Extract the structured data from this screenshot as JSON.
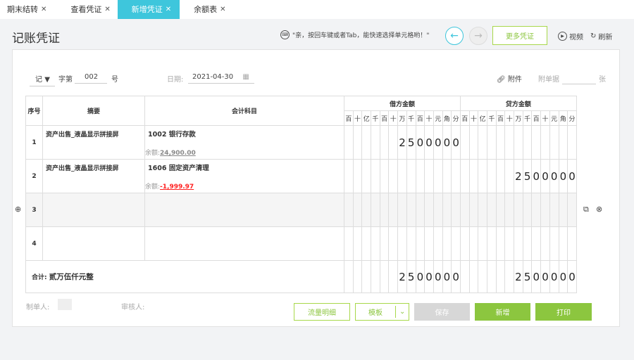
{
  "tabs": [
    {
      "label": "期末结转"
    },
    {
      "label": "查看凭证"
    },
    {
      "label": "新增凭证",
      "active": true
    },
    {
      "label": "余额表"
    }
  ],
  "page_title": "记账凭证",
  "hint": "\"亲，按回车键或者Tab，能快速选择单元格哟！\"",
  "more_vouchers": "更多凭证",
  "video": "视频",
  "refresh": "刷新",
  "voucher": {
    "type": "记",
    "word_label": "字第",
    "number": "002",
    "number_suffix": "号",
    "date_label": "日期:",
    "date": "2021-04-30",
    "attachment": "附件",
    "attach_count_label": "附单据",
    "attach_unit": "张"
  },
  "table": {
    "headers": {
      "index": "序号",
      "summary": "摘要",
      "account": "会计科目",
      "debit": "借方金额",
      "credit": "贷方金额"
    },
    "digit_units": [
      "百",
      "十",
      "亿",
      "千",
      "百",
      "十",
      "万",
      "千",
      "百",
      "十",
      "元",
      "角",
      "分"
    ],
    "rows": [
      {
        "index": "1",
        "summary": "资产出售_液晶显示拼接屏",
        "account": "1002 银行存款",
        "balance_label": "余额:",
        "balance": "24,900.00",
        "balance_negative": false,
        "debit": "2500000",
        "credit": ""
      },
      {
        "index": "2",
        "summary": "资产出售_液晶显示拼接屏",
        "account": "1606 固定资产清理",
        "balance_label": "余额:",
        "balance": "-1,999.97",
        "balance_negative": true,
        "debit": "",
        "credit": "2500000"
      },
      {
        "index": "3",
        "summary": "",
        "account": "",
        "debit": "",
        "credit": ""
      },
      {
        "index": "4",
        "summary": "",
        "account": "",
        "debit": "",
        "credit": ""
      }
    ],
    "total_label": "合计:",
    "total_words": "贰万伍仟元整",
    "total_debit": "2500000",
    "total_credit": "2500000"
  },
  "footer": {
    "maker_label": "制单人:",
    "reviewer_label": "审核人:"
  },
  "buttons": {
    "cash_flow": "流量明细",
    "template": "模板",
    "save": "保存",
    "new": "新增",
    "print": "打印"
  },
  "colors": {
    "accent": "#3ec6dc",
    "green": "#8cc63f",
    "negative": "#ff2020"
  }
}
